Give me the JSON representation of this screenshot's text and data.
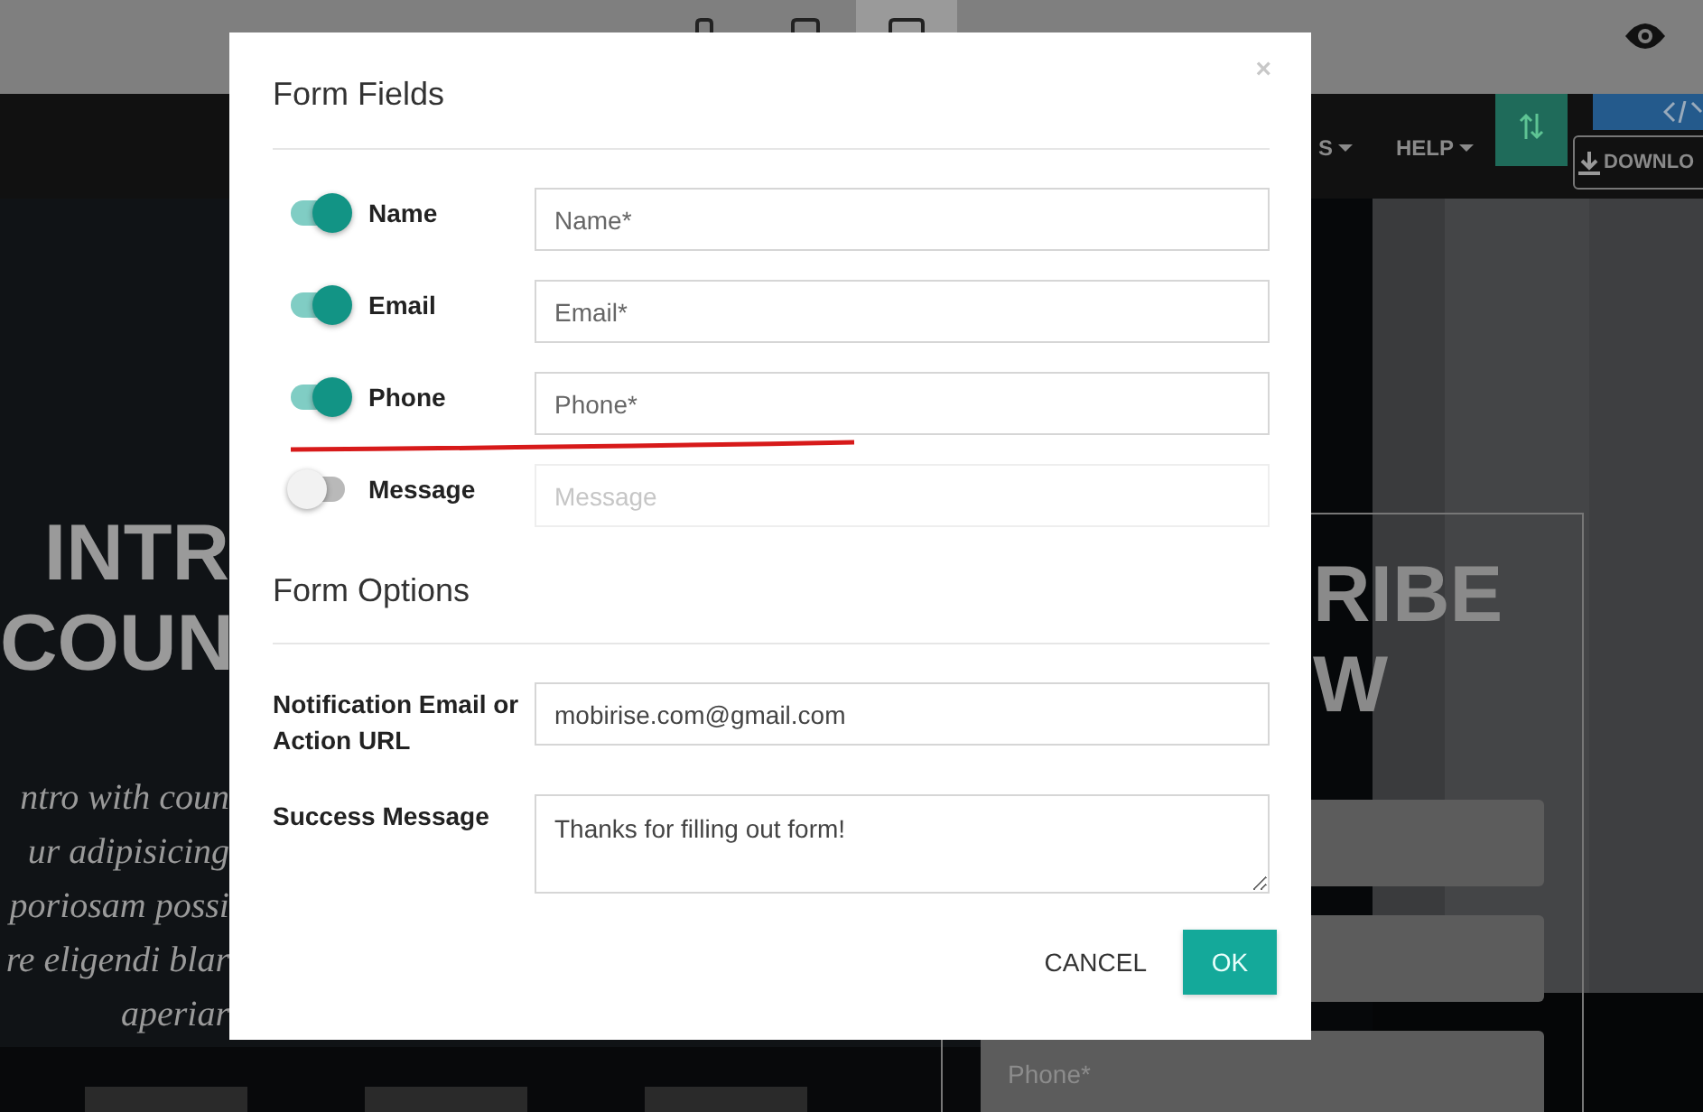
{
  "editor_toolbar": {
    "device_buttons": [
      {
        "kind": "phone",
        "selected": false
      },
      {
        "kind": "tablet",
        "selected": false
      },
      {
        "kind": "desktop",
        "selected": true
      }
    ]
  },
  "nav": {
    "items": [
      {
        "label": "S"
      },
      {
        "label": "HELP"
      }
    ],
    "download_button": {
      "label": "DOWNLO"
    }
  },
  "hero": {
    "title_lines": [
      "INTR",
      "COUN"
    ],
    "text_lines": [
      "ntro with coun",
      "ur adipisicing",
      "poriosam possi",
      "re eligendi blar",
      "aperiar"
    ]
  },
  "subscribe": {
    "title_lines": [
      "RIBE",
      "W"
    ],
    "fields": [
      {
        "kind": "blank"
      },
      {
        "kind": "blank"
      },
      {
        "kind": "input",
        "placeholder": "Phone*"
      }
    ]
  },
  "modal": {
    "title": "Form Fields",
    "close": "×",
    "fields": [
      {
        "label": "Name",
        "on": true,
        "placeholder": "Name*"
      },
      {
        "label": "Email",
        "on": true,
        "placeholder": "Email*"
      },
      {
        "label": "Phone",
        "on": true,
        "placeholder": "Phone*"
      },
      {
        "label": "Message",
        "on": false,
        "placeholder": "Message"
      }
    ],
    "options_title": "Form Options",
    "options": [
      {
        "kind": "input",
        "label": "Notification Email or Action URL",
        "value": "mobirise.com@gmail.com"
      },
      {
        "kind": "textarea",
        "label": "Success Message",
        "value": "Thanks for filling out form!"
      }
    ],
    "buttons": [
      {
        "kind": "text",
        "label": "CANCEL"
      },
      {
        "kind": "primary",
        "label": "OK"
      }
    ]
  }
}
